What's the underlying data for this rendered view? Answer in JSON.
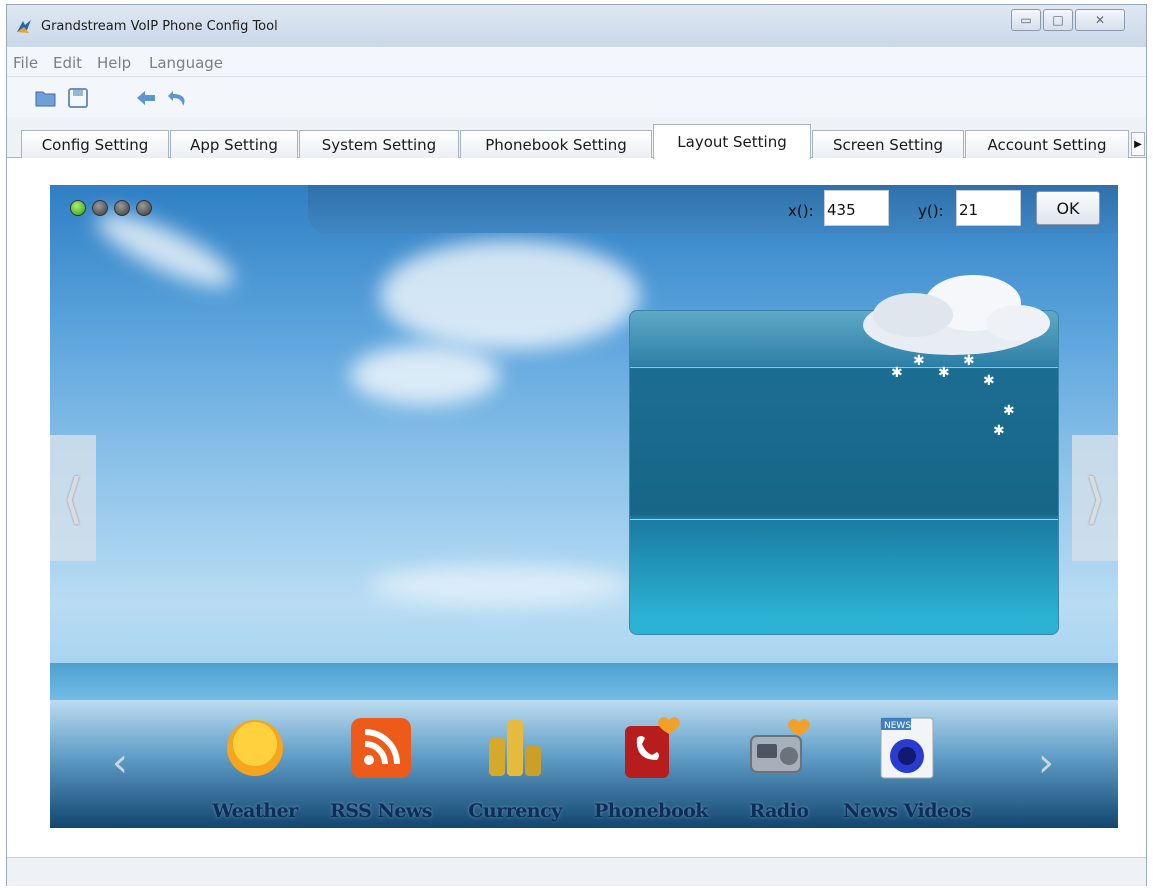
{
  "window": {
    "title": "Grandstream VoIP Phone Config Tool",
    "controls": {
      "minimize": "▭",
      "maximize": "□",
      "close": "✕"
    }
  },
  "menu": [
    "File",
    "Edit",
    "Help",
    "Language"
  ],
  "toolbar": {
    "icons": [
      "open-folder-icon",
      "save-icon",
      "back-arrow-icon",
      "undo-icon"
    ]
  },
  "tabs": [
    {
      "label": "Config Setting"
    },
    {
      "label": "App Setting"
    },
    {
      "label": "System Setting"
    },
    {
      "label": "Phonebook Setting"
    },
    {
      "label": "Layout Setting",
      "active": true
    },
    {
      "label": "Screen Setting"
    },
    {
      "label": "Account Setting"
    }
  ],
  "layout": {
    "x_label": "x():",
    "x_value": "435",
    "y_label": "y():",
    "y_value": "21",
    "ok_label": "OK",
    "page_arrows": {
      "left": "⟨",
      "right": "⟩"
    },
    "dock_arrows": {
      "left": "‹",
      "right": "›"
    }
  },
  "apps": [
    {
      "label": "Weather",
      "icon": "sun-icon"
    },
    {
      "label": "RSS News",
      "icon": "rss-icon"
    },
    {
      "label": "Currency",
      "icon": "coins-icon"
    },
    {
      "label": "Phonebook",
      "icon": "phonebook-icon"
    },
    {
      "label": "Radio",
      "icon": "radio-icon"
    },
    {
      "label": "News Videos",
      "icon": "news-video-icon"
    }
  ],
  "colors": {
    "sky_top": "#2f7fc4",
    "dock_label": "#0c2d5a",
    "active_indicator": "#2c9d15"
  }
}
